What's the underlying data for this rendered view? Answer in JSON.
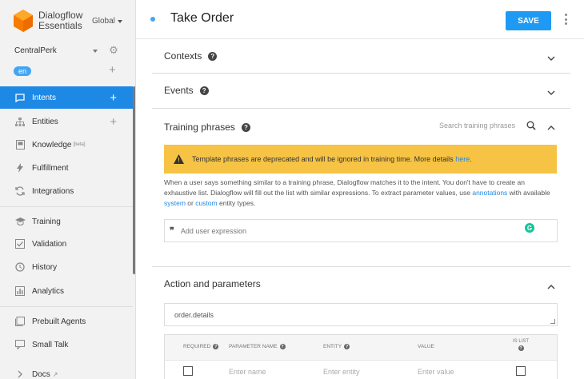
{
  "app": {
    "name_line1": "Dialogflow",
    "name_line2": "Essentials",
    "region": "Global"
  },
  "agent": {
    "name": "CentralPerk",
    "language": "en"
  },
  "sidebar": {
    "items": [
      {
        "label": "Intents",
        "icon": "chat-icon",
        "active": true,
        "plus": true
      },
      {
        "label": "Entities",
        "icon": "sitemap-icon",
        "plus": true
      },
      {
        "label": "Knowledge",
        "sup": "[beta]",
        "icon": "book-icon"
      },
      {
        "label": "Fulfillment",
        "icon": "bolt-icon"
      },
      {
        "label": "Integrations",
        "icon": "sync-icon"
      },
      {
        "label": "Training",
        "icon": "graduation-cap-icon"
      },
      {
        "label": "Validation",
        "icon": "check-box-icon"
      },
      {
        "label": "History",
        "icon": "clock-icon"
      },
      {
        "label": "Analytics",
        "icon": "bar-chart-icon"
      },
      {
        "label": "Prebuilt Agents",
        "icon": "book-stack-icon"
      },
      {
        "label": "Small Talk",
        "icon": "speech-bubble-icon"
      },
      {
        "label": "Docs",
        "icon": "chevron-right-icon"
      }
    ]
  },
  "header": {
    "title": "Take Order",
    "save_label": "SAVE"
  },
  "sections": {
    "contexts": "Contexts",
    "events": "Events",
    "training": "Training phrases",
    "action": "Action and parameters"
  },
  "training": {
    "search_placeholder": "Search training phrases",
    "warning_text": "Template phrases are deprecated and will be ignored in training time. More details ",
    "warning_link": "here",
    "desc_1": "When a user says something similar to a training phrase, Dialogflow matches it to the intent. You don't have to create an exhaustive list. Dialogflow will fill out the list with similar expressions. To extract parameter values, use ",
    "desc_link_1": "annotations",
    "desc_2": " with available ",
    "desc_link_2": "system",
    "desc_3": " or ",
    "desc_link_3": "custom",
    "desc_4": " entity types.",
    "expression_placeholder": "Add user expression"
  },
  "action": {
    "action_name": "order.details",
    "columns": {
      "required": "REQUIRED",
      "param_name": "PARAMETER NAME",
      "entity": "ENTITY",
      "value": "VALUE",
      "is_list_1": "IS LIST"
    },
    "row": {
      "name_placeholder": "Enter name",
      "entity_placeholder": "Enter entity",
      "value_placeholder": "Enter value"
    }
  },
  "colors": {
    "accent": "#1e88e5",
    "save": "#1e9af4",
    "warning": "#f6c344",
    "sidebar_bg": "#f2f2f2"
  }
}
